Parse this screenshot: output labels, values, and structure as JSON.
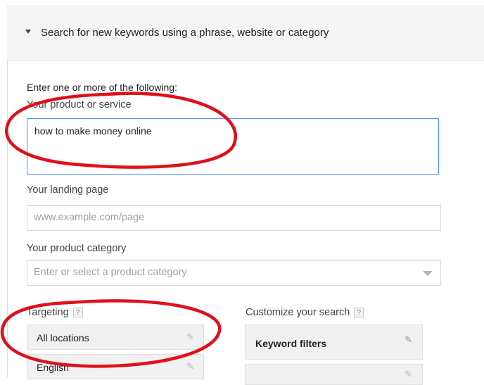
{
  "header": {
    "title": "Search for new keywords using a phrase, website or category"
  },
  "form": {
    "intro": "Enter one or more of the following:",
    "product": {
      "label": "Your product or service",
      "value": "how to make money online"
    },
    "landing": {
      "label": "Your landing page",
      "placeholder": "www.example.com/page"
    },
    "category": {
      "label": "Your product category",
      "placeholder": "Enter or select a product category"
    }
  },
  "targeting": {
    "label": "Targeting",
    "help": "?",
    "items": [
      {
        "label": "All locations",
        "icon": "pencil-icon"
      },
      {
        "label": "English",
        "icon": "pencil-icon"
      }
    ]
  },
  "customize": {
    "label": "Customize your search",
    "help": "?",
    "items": [
      {
        "label": "Keyword filters",
        "icon": "pencil-icon"
      }
    ]
  },
  "annotations": {
    "color": "#e0101a"
  }
}
